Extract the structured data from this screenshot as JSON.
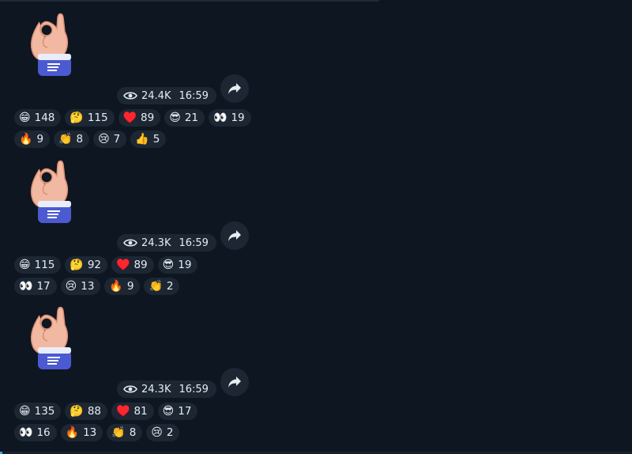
{
  "posts": [
    {
      "views": "24.4K",
      "time": "16:59",
      "reactions_row1": [
        {
          "emoji": "😁",
          "count": "148"
        },
        {
          "emoji": "🤔",
          "count": "115"
        },
        {
          "emoji": "♥️",
          "count": "89"
        },
        {
          "emoji": "😎",
          "count": "21"
        },
        {
          "emoji": "👀",
          "count": "19"
        }
      ],
      "reactions_row2": [
        {
          "emoji": "🔥",
          "count": "9"
        },
        {
          "emoji": "👏",
          "count": "8"
        },
        {
          "emoji": "😢",
          "count": "7"
        },
        {
          "emoji": "👍",
          "count": "5"
        }
      ]
    },
    {
      "views": "24.3K",
      "time": "16:59",
      "reactions_row1": [
        {
          "emoji": "😁",
          "count": "115"
        },
        {
          "emoji": "🤔",
          "count": "92"
        },
        {
          "emoji": "♥️",
          "count": "89"
        },
        {
          "emoji": "😎",
          "count": "19"
        }
      ],
      "reactions_row2": [
        {
          "emoji": "👀",
          "count": "17"
        },
        {
          "emoji": "😢",
          "count": "13"
        },
        {
          "emoji": "🔥",
          "count": "9"
        },
        {
          "emoji": "👏",
          "count": "2"
        }
      ]
    },
    {
      "views": "24.3K",
      "time": "16:59",
      "reactions_row1": [
        {
          "emoji": "😁",
          "count": "135"
        },
        {
          "emoji": "🤔",
          "count": "88"
        },
        {
          "emoji": "♥️",
          "count": "81"
        },
        {
          "emoji": "😎",
          "count": "17"
        }
      ],
      "reactions_row2": [
        {
          "emoji": "👀",
          "count": "16"
        },
        {
          "emoji": "🔥",
          "count": "13"
        },
        {
          "emoji": "👏",
          "count": "8"
        },
        {
          "emoji": "😢",
          "count": "2"
        }
      ]
    }
  ],
  "colors": {
    "background": "#0e1621",
    "pill": "#1c2733",
    "text": "#e6ecf2"
  }
}
